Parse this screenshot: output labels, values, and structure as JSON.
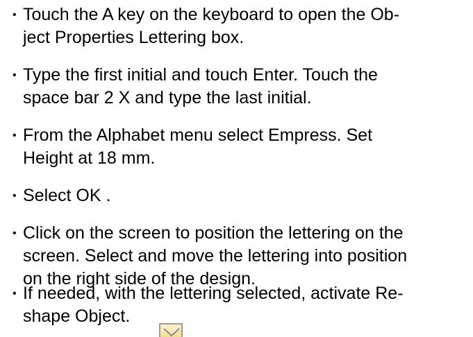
{
  "instructions": {
    "bullet": "•",
    "items": [
      {
        "lines": [
          "Touch the A key on the keyboard to open the Ob-",
          "ject Properties Lettering box."
        ]
      },
      {
        "lines": [
          "Type the first initial and touch Enter. Touch the",
          "space bar 2 X and type the last initial."
        ]
      },
      {
        "lines": [
          "From the Alphabet menu select Empress. Set",
          "Height at 18 mm."
        ]
      },
      {
        "lines": [
          "Select OK ."
        ]
      },
      {
        "lines": [
          "Click on the screen to position the lettering on the",
          "screen. Select and move the lettering into position",
          "on the right side of the design."
        ]
      },
      {
        "lines": [
          "If needed, with the lettering selected, activate Re-",
          "shape Object."
        ]
      }
    ]
  },
  "icons": {
    "reshape_object": "reshape-object-icon",
    "icon_stroke": "#7a8fa6",
    "icon_background": "#f9dc8c"
  }
}
